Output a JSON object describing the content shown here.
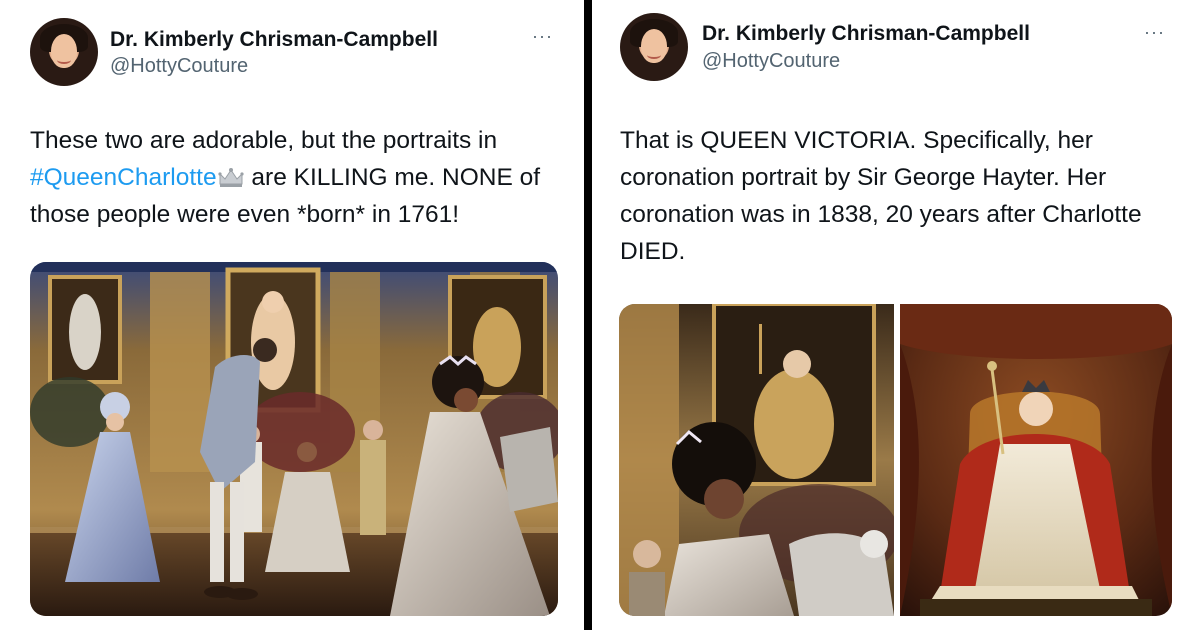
{
  "left_tweet": {
    "author_name": "Dr. Kimberly Chrisman-Campbell",
    "author_handle": "@HottyCouture",
    "more_label": "···",
    "text_part1": "These two are adorable, but the portraits in ",
    "hashtag": "#QueenCharlotte",
    "text_part2": " are KILLING me. NONE of those people were even *born* in 1761!",
    "media_description_icon": "ballroom-scene-image"
  },
  "right_tweet": {
    "author_name": "Dr. Kimberly Chrisman-Campbell",
    "author_handle": "@HottyCouture",
    "more_label": "···",
    "text": "That is QUEEN VICTORIA. Specifically, her coronation portrait by Sir George Hayter. Her coronation was in 1838, 20 years after Charlotte DIED.",
    "media_icons": [
      "ballroom-closeup-image",
      "victoria-portrait-image"
    ]
  },
  "colors": {
    "text": "#0f1419",
    "secondary": "#536471",
    "hashtag": "#1d9bf0",
    "divider": "#000000"
  }
}
